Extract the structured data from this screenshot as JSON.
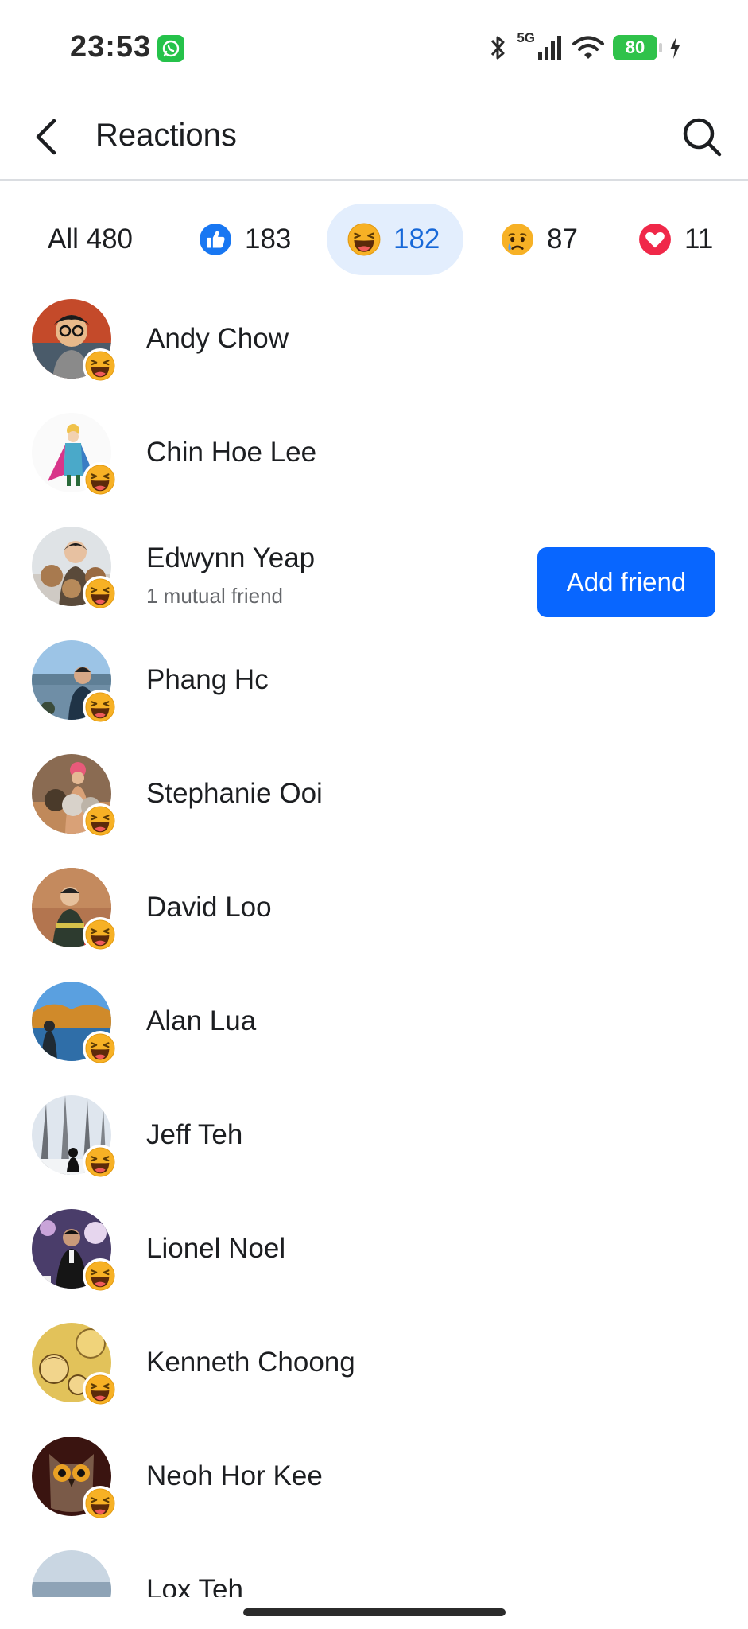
{
  "status_bar": {
    "time": "23:53",
    "network": "5G",
    "battery": "80"
  },
  "header": {
    "title": "Reactions"
  },
  "tabs": [
    {
      "label": "All 480",
      "icon": "none"
    },
    {
      "count": "183",
      "icon": "like-icon"
    },
    {
      "count": "182",
      "icon": "haha-icon",
      "active": true
    },
    {
      "count": "87",
      "icon": "sad-icon"
    },
    {
      "count": "11",
      "icon": "love-icon"
    }
  ],
  "people": [
    {
      "name": "Andy Chow",
      "reaction": "haha-icon"
    },
    {
      "name": "Chin Hoe Lee",
      "reaction": "haha-icon"
    },
    {
      "name": "Edwynn Yeap",
      "subtitle": "1 mutual friend",
      "action": "Add friend",
      "reaction": "haha-icon"
    },
    {
      "name": "Phang Hc",
      "reaction": "haha-icon"
    },
    {
      "name": "Stephanie Ooi",
      "reaction": "haha-icon"
    },
    {
      "name": "David Loo",
      "reaction": "haha-icon"
    },
    {
      "name": "Alan Lua",
      "reaction": "haha-icon"
    },
    {
      "name": "Jeff Teh",
      "reaction": "haha-icon"
    },
    {
      "name": "Lionel Noel",
      "reaction": "haha-icon"
    },
    {
      "name": "Kenneth Choong",
      "reaction": "haha-icon"
    },
    {
      "name": "Neoh Hor Kee",
      "reaction": "haha-icon"
    },
    {
      "name": "Lox Teh",
      "reaction": "haha-icon"
    }
  ],
  "colors": {
    "accent": "#0866ff",
    "active_tab_bg": "#e3eefd",
    "active_tab_text": "#1768d8",
    "haha": "#f7b125"
  }
}
